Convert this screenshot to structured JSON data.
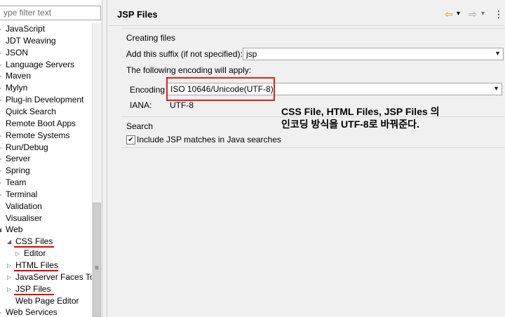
{
  "filter": {
    "placeholder": "ype filter text"
  },
  "tree": {
    "items": [
      {
        "label": "JavaScript",
        "expander": "▷",
        "indent": 0
      },
      {
        "label": "JDT Weaving",
        "expander": "",
        "indent": 0
      },
      {
        "label": "JSON",
        "expander": "▷",
        "indent": 0
      },
      {
        "label": "Language Servers",
        "expander": "▷",
        "indent": 0
      },
      {
        "label": "Maven",
        "expander": "▷",
        "indent": 0
      },
      {
        "label": "Mylyn",
        "expander": "▷",
        "indent": 0
      },
      {
        "label": "Plug-in Development",
        "expander": "▷",
        "indent": 0
      },
      {
        "label": "Quick Search",
        "expander": "",
        "indent": 0
      },
      {
        "label": "Remote Boot Apps",
        "expander": "",
        "indent": 0
      },
      {
        "label": "Remote Systems",
        "expander": "▷",
        "indent": 0
      },
      {
        "label": "Run/Debug",
        "expander": "▷",
        "indent": 0
      },
      {
        "label": "Server",
        "expander": "▷",
        "indent": 0
      },
      {
        "label": "Spring",
        "expander": "▷",
        "indent": 0
      },
      {
        "label": "Team",
        "expander": "▷",
        "indent": 0
      },
      {
        "label": "Terminal",
        "expander": "▷",
        "indent": 0
      },
      {
        "label": "Validation",
        "expander": "",
        "indent": 0
      },
      {
        "label": "Visualiser",
        "expander": "",
        "indent": 0
      },
      {
        "label": "Web",
        "expander": "◢",
        "indent": 0
      },
      {
        "label": "CSS Files",
        "expander": "◢",
        "indent": 1,
        "underline": true
      },
      {
        "label": "Editor",
        "expander": "▷",
        "indent": 2
      },
      {
        "label": "HTML Files",
        "expander": "▷",
        "indent": 1,
        "underline": true
      },
      {
        "label": "JavaServer Faces Too",
        "expander": "▷",
        "indent": 1
      },
      {
        "label": "JSP Files",
        "expander": "▷",
        "indent": 1,
        "underline": true
      },
      {
        "label": "Web Page Editor",
        "expander": "",
        "indent": 1
      },
      {
        "label": "Web Services",
        "expander": "▷",
        "indent": 0
      }
    ]
  },
  "page": {
    "title": "JSP Files"
  },
  "nav": {
    "back": "⇦",
    "back_menu": "▾",
    "forward": "⇨",
    "forward_menu": "▾",
    "view_menu": "⋮"
  },
  "creating": {
    "group_label": "Creating files",
    "suffix_label": "Add this suffix (if not specified):",
    "suffix_value": "jsp",
    "encoding_note": "The following encoding will apply:",
    "encoding_label": "Encoding",
    "encoding_value": "ISO 10646/Unicode(UTF-8)",
    "iana_label": "IANA:",
    "iana_value": "UTF-8"
  },
  "annotation": {
    "line1": "CSS File, HTML Files, JSP Files 의",
    "line2": "인코딩 방식을 UTF-8로 바꿔준다."
  },
  "search": {
    "group_label": "Search",
    "include_label": "Include JSP matches in Java searches",
    "checked": true
  },
  "colors": {
    "annotation_red": "#e02020"
  }
}
